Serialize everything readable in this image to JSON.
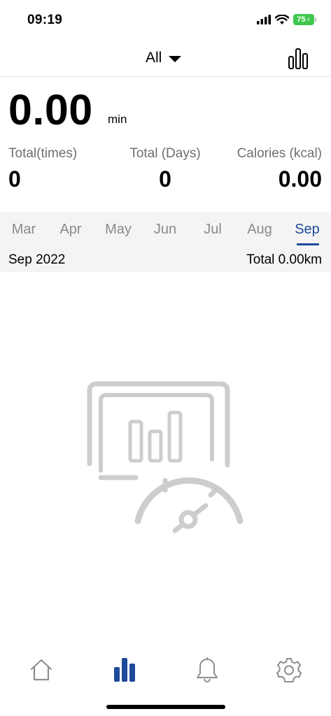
{
  "status_bar": {
    "time": "09:19",
    "battery": "75"
  },
  "header": {
    "filter_label": "All"
  },
  "summary": {
    "duration_value": "0.00",
    "duration_unit": "min"
  },
  "stats": [
    {
      "label": "Total(times)",
      "value": "0"
    },
    {
      "label": "Total (Days)",
      "value": "0"
    },
    {
      "label": "Calories (kcal)",
      "value": "0.00"
    }
  ],
  "months": {
    "items": [
      "Mar",
      "Apr",
      "May",
      "Jun",
      "Jul",
      "Aug",
      "Sep"
    ],
    "selected": "Sep"
  },
  "period": {
    "label": "Sep 2022",
    "total": "Total 0.00km"
  },
  "colors": {
    "accent": "#1f4a9a",
    "muted_text": "#8a8a8a",
    "panel_bg": "#f4f4f4",
    "illustration": "#cdcdcd",
    "tab_icon": "#8e8e8e",
    "battery": "#3fc84d"
  },
  "tab_bar": {
    "items": [
      "home-icon",
      "stats-bar-icon",
      "bell-icon",
      "gear-icon"
    ],
    "active": "stats-bar-icon"
  }
}
